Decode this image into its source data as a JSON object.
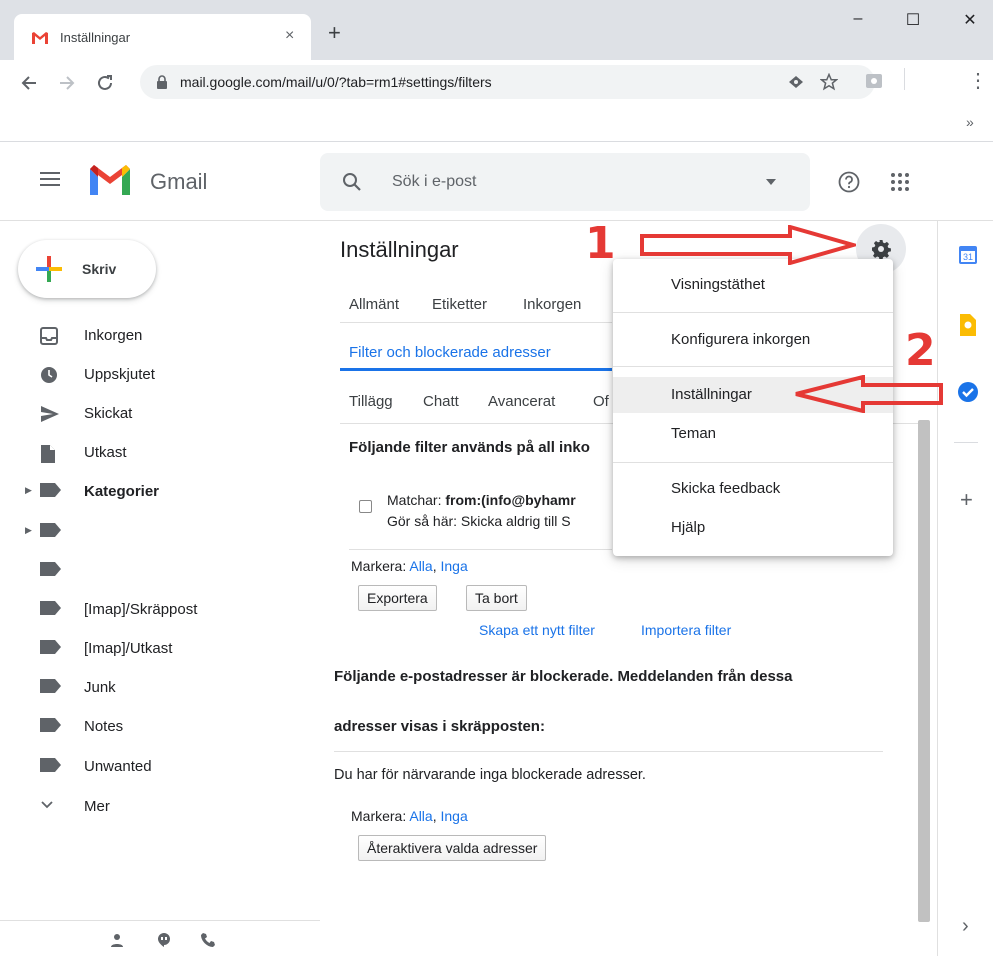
{
  "browser": {
    "tab_title": "Inställningar",
    "new_tab": "+",
    "close_tab": "×",
    "url": "mail.google.com/mail/u/0/?tab=rm1#settings/filters",
    "minimize": "–",
    "maximize": "☐",
    "close": "✕",
    "more": "⋮",
    "extensions_more": "»"
  },
  "gmail": {
    "logo_text": "Gmail",
    "search_placeholder": "Sök i e-post",
    "compose": "Skriv"
  },
  "sidebar": {
    "items": [
      {
        "label": "Inkorgen",
        "icon": "inbox-icon"
      },
      {
        "label": "Uppskjutet",
        "icon": "clock-icon"
      },
      {
        "label": "Skickat",
        "icon": "send-icon"
      },
      {
        "label": "Utkast",
        "icon": "draft-icon"
      },
      {
        "label": "Kategorier",
        "icon": "label-icon",
        "bold": true,
        "arrow": "▶"
      },
      {
        "label": "",
        "icon": "label-icon",
        "arrow": "▶"
      },
      {
        "label": "",
        "icon": "label-icon"
      },
      {
        "label": "[Imap]/Skräppost",
        "icon": "label-icon"
      },
      {
        "label": "[Imap]/Utkast",
        "icon": "label-icon"
      },
      {
        "label": "Junk",
        "icon": "label-icon"
      },
      {
        "label": "Notes",
        "icon": "label-icon"
      },
      {
        "label": "Unwanted",
        "icon": "label-icon"
      },
      {
        "label": "Mer",
        "icon": "chevron-down-icon"
      }
    ]
  },
  "settings": {
    "title": "Inställningar",
    "tabs_row1": [
      "Allmänt",
      "Etiketter",
      "Inkorgen"
    ],
    "tab_active": "Filter och blockerade adresser",
    "tabs_row3": [
      "Tillägg",
      "Chatt",
      "Avancerat",
      "Of"
    ],
    "filters_heading": "Följande filter används på all inko",
    "filter_match_label": "Matchar: ",
    "filter_match_value": "from:(info@byhamr",
    "filter_action": "Gör så här: Skicka aldrig till S",
    "select_label": "Markera: ",
    "select_all": "Alla",
    "select_none": "Inga",
    "export_btn": "Exportera",
    "delete_btn": "Ta bort",
    "create_filter": "Skapa ett nytt filter",
    "import_filter": "Importera filter",
    "blocked_heading_1": "Följande e-postadresser är blockerade. Meddelanden från dessa",
    "blocked_heading_2": "adresser visas i skräpposten:",
    "no_blocked": "Du har för närvarande inga blockerade adresser.",
    "reactivate_btn": "Återaktivera valda adresser",
    "comma": ","
  },
  "menu": {
    "items": [
      "Visningstäthet",
      "Konfigurera inkorgen",
      "Inställningar",
      "Teman",
      "Skicka feedback",
      "Hjälp"
    ]
  },
  "annotations": {
    "step1": "1",
    "step2": "2"
  },
  "right_panel": {
    "calendar_day": "31",
    "add": "+",
    "expand": "›"
  },
  "colors": {
    "accent": "#1a73e8",
    "annotation": "#e53935",
    "gmail_red": "#ea4335"
  }
}
